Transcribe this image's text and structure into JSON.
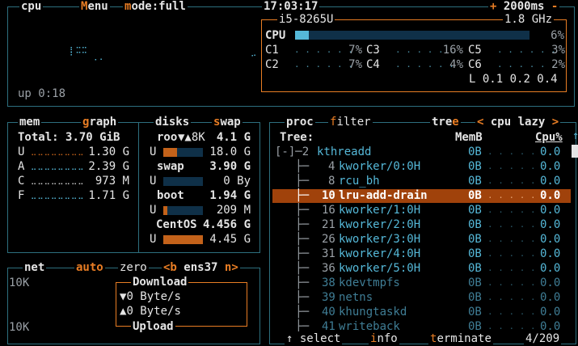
{
  "cpu_header": {
    "cpu": "cpu",
    "menu_m": "M",
    "menu_rest": "enu",
    "mode_m": "m",
    "mode_rest": "ode:",
    "mode_val": "full",
    "clock": "17:03:17",
    "plus": "+",
    "interval": "2000ms",
    "minus": "-"
  },
  "cpu_info": {
    "model": "i5-8265U",
    "freq": "1.8 GHz",
    "total_label": "CPU",
    "total_pct": "6%",
    "total_value": 0.06
  },
  "cores": [
    {
      "label": "C1",
      "pct": "7%"
    },
    {
      "label": "C2",
      "pct": "7%"
    },
    {
      "label": "C3",
      "pct": "16%"
    },
    {
      "label": "C4",
      "pct": "4%"
    },
    {
      "label": "C5",
      "pct": "3%"
    },
    {
      "label": "C6",
      "pct": "2%"
    }
  ],
  "load": {
    "label": "L",
    "values": "0.1 0.2 0.4"
  },
  "uptime": "up 0:18",
  "mem": {
    "title": "mem",
    "graph_g": "g",
    "graph_rest": "raph",
    "total_label": "Total:",
    "total_value": "3.70 GiB",
    "rows": [
      {
        "k": "U",
        "v": "1.30 G"
      },
      {
        "k": "A",
        "v": "2.39 G"
      },
      {
        "k": "C",
        "v": "973 M"
      },
      {
        "k": "F",
        "v": "1.71 G"
      }
    ]
  },
  "disks": {
    "title": "disks",
    "swap_s": "s",
    "swap_rest": "wap",
    "items": [
      {
        "name": "roo",
        "io": "▼▲8K",
        "total": "4.1",
        "unit": "G",
        "used": "18.0",
        "used_unit": "G",
        "fill": 0.35,
        "color": "#c3621a"
      },
      {
        "name": "swap",
        "total": "3.90",
        "unit": "G",
        "used": "0",
        "used_unit": "By",
        "fill": 0.0,
        "color": "#c3621a"
      },
      {
        "name": "boot",
        "total": "1.94",
        "unit": "G",
        "used": "209",
        "used_unit": "M",
        "fill": 0.1,
        "color": "#c3621a"
      },
      {
        "name": "CentOS",
        "total": "4.456",
        "unit": "G",
        "used": "4.45",
        "used_unit": "G",
        "fill": 1.0,
        "color": "#c3621a"
      }
    ]
  },
  "net": {
    "title": "net",
    "auto": "auto",
    "zero": "zero",
    "b": "<b",
    "iface": "ens37",
    "n": "n>",
    "scale_top": "10K",
    "scale_bottom": "10K",
    "download": "Download",
    "upload": "Upload",
    "down_rate": "0 Byte/s",
    "up_rate": "0 Byte/s"
  },
  "proc": {
    "title": "proc",
    "filter_f": "f",
    "filter_rest": "ilter",
    "tree_t": "tre",
    "tree_e": "e",
    "lt": "<",
    "sort": "cpu lazy",
    "gt": ">",
    "col_tree": "Tree:",
    "col_mem": "MemB",
    "col_cpu": "Cpu%",
    "rows": [
      {
        "prefix": "[-]─2",
        "pid": "",
        "name": "kthreadd",
        "mem": "0B",
        "cpu": "0.0",
        "sel": false,
        "faded": false
      },
      {
        "prefix": "   ├─",
        "pid": "4",
        "name": "kworker/0:0H",
        "mem": "0B",
        "cpu": "0.0",
        "sel": false,
        "faded": false
      },
      {
        "prefix": "   ├─",
        "pid": "8",
        "name": "rcu_bh",
        "mem": "0B",
        "cpu": "0.0",
        "sel": false,
        "faded": false
      },
      {
        "prefix": "   ├─",
        "pid": "10",
        "name": "lru-add-drain",
        "mem": "0B",
        "cpu": "0.0",
        "sel": true,
        "faded": false
      },
      {
        "prefix": "   ├─",
        "pid": "16",
        "name": "kworker/1:0H",
        "mem": "0B",
        "cpu": "0.0",
        "sel": false,
        "faded": false
      },
      {
        "prefix": "   ├─",
        "pid": "21",
        "name": "kworker/2:0H",
        "mem": "0B",
        "cpu": "0.0",
        "sel": false,
        "faded": false
      },
      {
        "prefix": "   ├─",
        "pid": "26",
        "name": "kworker/3:0H",
        "mem": "0B",
        "cpu": "0.0",
        "sel": false,
        "faded": false
      },
      {
        "prefix": "   ├─",
        "pid": "31",
        "name": "kworker/4:0H",
        "mem": "0B",
        "cpu": "0.0",
        "sel": false,
        "faded": false
      },
      {
        "prefix": "   ├─",
        "pid": "36",
        "name": "kworker/5:0H",
        "mem": "0B",
        "cpu": "0.0",
        "sel": false,
        "faded": false
      },
      {
        "prefix": "   ├─",
        "pid": "38",
        "name": "kdevtmpfs",
        "mem": "0B",
        "cpu": "0.0",
        "sel": false,
        "faded": true
      },
      {
        "prefix": "   ├─",
        "pid": "39",
        "name": "netns",
        "mem": "0B",
        "cpu": "0.0",
        "sel": false,
        "faded": true
      },
      {
        "prefix": "   ├─",
        "pid": "40",
        "name": "khungtaskd",
        "mem": "0B",
        "cpu": "0.0",
        "sel": false,
        "faded": true
      },
      {
        "prefix": "   ├─",
        "pid": "41",
        "name": "writeback",
        "mem": "0B",
        "cpu": "0.0",
        "sel": false,
        "faded": true
      }
    ],
    "footer": {
      "select": "↑ select",
      "info_i": "i",
      "info_rest": "nfo",
      "term_t": "t",
      "term_rest": "erminate",
      "count": "4/209"
    }
  },
  "colors": {
    "border": "#2d6f7e",
    "accent": "#e87d24",
    "text": "#e5e5e5",
    "selected": "#a0420b",
    "cyan": "#55b8d8"
  }
}
